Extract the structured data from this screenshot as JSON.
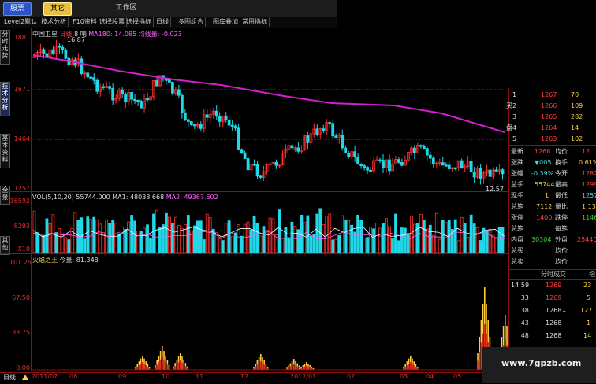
{
  "top_tabs": [
    {
      "label": "股票",
      "active": true
    },
    {
      "label": "其它",
      "active": false
    }
  ],
  "workspace_label": "工作区",
  "menu_items": [
    "Level2默认",
    "技术分析",
    "F10资料",
    "选择股票",
    "选择指标",
    "日线",
    "多图组合",
    "图库叠加",
    "常用指标"
  ],
  "side_tabs": [
    "分时走势",
    "技术分析",
    "基本资料",
    "全景",
    "其他"
  ],
  "price_panel": {
    "legend_stock": "中国卫星",
    "legend_period": "日线",
    "legend_adj": "8",
    "legend_ma": "MA180: 14.085",
    "legend_trend": "均线量: -0.023",
    "legend_rest": "吧",
    "annot": "16.87",
    "axis": [
      "1881",
      "1671",
      "1464",
      "1257"
    ],
    "low_marker": "12.57"
  },
  "vol_panel": {
    "legend_vol": "VOL(5,10,20)",
    "legend_vol_value": "55744.000",
    "legend_ma1": "MA1: 48038.668",
    "legend_ma2": "MA2: 49367.602",
    "axis": [
      "16592",
      "8293",
      "X10"
    ]
  },
  "ind_panel": {
    "name": "火焰之王",
    "legend": "今量: 81.348",
    "axis": [
      "101.25",
      "67.50",
      "33.75",
      "0.00"
    ]
  },
  "date_axis": {
    "label": "日线",
    "ticks": [
      "2011/07",
      "08",
      "09",
      "10",
      "11",
      "12",
      "2012/01",
      "02",
      "03",
      "04",
      "05"
    ]
  },
  "quote": {
    "orderbook": [
      {
        "side": "卖",
        "level": "1",
        "price": "1267",
        "vol": "70"
      },
      {
        "side": "卖",
        "level": "2",
        "price": "1266",
        "vol": "109"
      },
      {
        "side": "卖",
        "level": "3",
        "price": "1265",
        "vol": "282"
      },
      {
        "side": "卖",
        "level": "4",
        "price": "1264",
        "vol": "14"
      },
      {
        "side": "卖",
        "level": "5",
        "price": "1263",
        "vol": "102"
      }
    ],
    "book_side_1": "买",
    "book_side_2": "盘",
    "rows": [
      {
        "l1": "最新",
        "v1": "1268",
        "l2": "均价",
        "v2": "12"
      },
      {
        "l1": "涨跌",
        "v1": "▼005",
        "l2": "换手",
        "v2": "0.61%"
      },
      {
        "l1": "涨幅",
        "v1": "-0.39%",
        "l2": "今开",
        "v2": "1282"
      },
      {
        "l1": "总手",
        "v1": "55744",
        "l2": "最高",
        "v2": "1299"
      },
      {
        "l1": "现手",
        "v1": "1",
        "l2": "最低",
        "v2": "1257"
      },
      {
        "l1": "总笔",
        "v1": "7112",
        "l2": "量比",
        "v2": "1.13"
      },
      {
        "l1": "涨停",
        "v1": "1400",
        "l2": "跌停",
        "v2": "1146"
      },
      {
        "l1": "总笔",
        "v1": "",
        "l2": "每笔",
        "v2": ""
      },
      {
        "l1": "内盘",
        "v1": "30304",
        "l2": "外盘",
        "v2": "25440"
      },
      {
        "l1": "总买",
        "v1": "",
        "l2": "均价",
        "v2": ""
      },
      {
        "l1": "总卖",
        "v1": "",
        "l2": "均价",
        "v2": ""
      }
    ],
    "ticks_header": "分时成交",
    "ticks_side": "指",
    "ticks": [
      {
        "time": "14:59",
        "price": "1269",
        "vol": "23"
      },
      {
        "time": ":33",
        "price": "1269",
        "vol": "5"
      },
      {
        "time": ":38",
        "price": "1268↓",
        "vol": "127"
      },
      {
        "time": ":43",
        "price": "1268",
        "vol": "1"
      },
      {
        "time": ":48",
        "price": "1268",
        "vol": "14"
      }
    ]
  },
  "watermark": "www.7gpzb.com",
  "colors": {
    "up": "#ff3030",
    "down": "#20d8e8",
    "ma180": "#d020d0",
    "axis": "#e03030"
  }
}
